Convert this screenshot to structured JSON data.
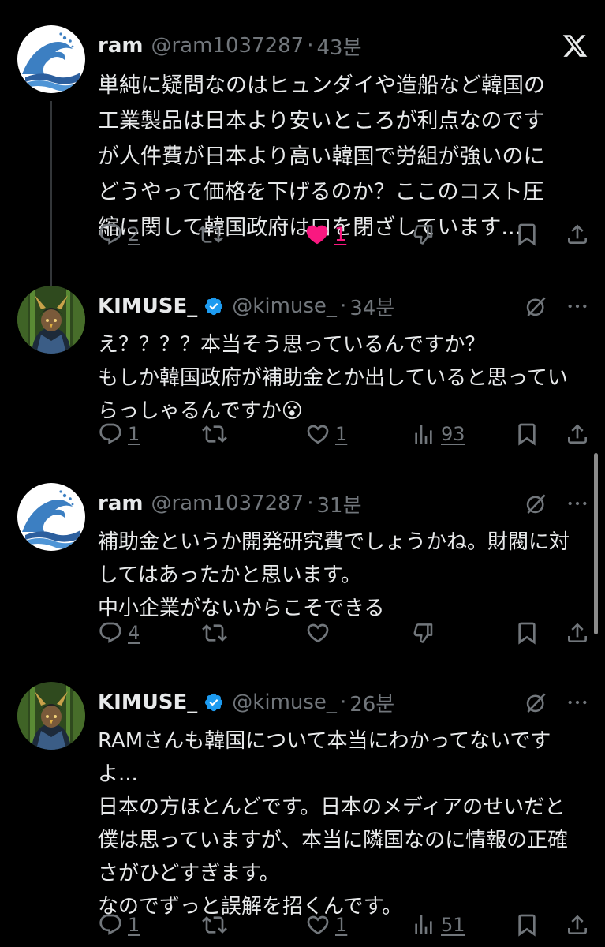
{
  "tweets": [
    {
      "name": "ram",
      "handle": "@ram1037287",
      "sep": "·",
      "time": "43분",
      "lines": [
        "単純に疑問なのはヒュンダイや造船など韓国の",
        "工業製品は日本より安いところが利点なのです",
        "が人件費が日本より高い韓国で労組が強いのに",
        "どうやって価格を下げるのか？ここのコスト圧",
        "縮に関して韓国政府は口を閉ざしています..."
      ],
      "reply_count": "2",
      "like_count": "1"
    },
    {
      "name": "KIMUSE_",
      "handle": "@kimuse_",
      "sep": "·",
      "time": "34분",
      "lines": [
        "え？？？？本当そう思っているんですか？",
        "もしか韓国政府が補助金とか出していると思ってい",
        "らっしゃるんですか"
      ],
      "emoji": "😮",
      "reply_count": "1",
      "like_count": "1",
      "view_count": "93"
    },
    {
      "name": "ram",
      "handle": "@ram1037287",
      "sep": "·",
      "time": "31분",
      "lines": [
        "補助金というか開発研究費でしょうかね。財閥に対",
        "してはあったかと思います。",
        "中小企業がないからこそできる"
      ],
      "reply_count": "4"
    },
    {
      "name": "KIMUSE_",
      "handle": "@kimuse_",
      "sep": "·",
      "time": "26분",
      "lines": [
        "RAMさんも韓国について本当にわかってないです",
        "よ...",
        "日本の方ほとんどです。日本のメディアのせいだと",
        "僕は思っていますが、本当に隣国なのに情報の正確",
        "さがひどすぎます。",
        "なのでずっと誤解を招くんです。"
      ],
      "reply_count": "1",
      "like_count": "1",
      "view_count": "51"
    }
  ],
  "colors": {
    "accent_like": "#f91880",
    "verified": "#1d9bf0",
    "muted": "#71767b"
  }
}
